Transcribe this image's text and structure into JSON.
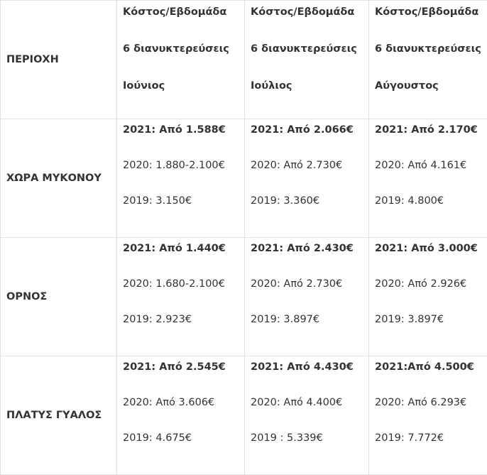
{
  "header": {
    "area_label": "ΠΕΡΙΟΧΗ",
    "columns": [
      {
        "line1": "Κόστος/Εβδομάδα",
        "line2": "6 διανυκτερεύσεις",
        "line3": "Ιούνιος"
      },
      {
        "line1": "Κόστος/Εβδομάδα",
        "line2": "6 διανυκτερεύσεις",
        "line3": "Ιούλιος"
      },
      {
        "line1": "Κόστος/Εβδομάδα",
        "line2": "6 διανυκτερεύσεις",
        "line3": "Αύγουστος"
      }
    ]
  },
  "rows": [
    {
      "area": "ΧΩΡΑ ΜΥΚΟΝΟΥ",
      "cells": [
        {
          "y2021": "2021: Από 1.588€",
          "y2020": "2020: 1.880-2.100€",
          "y2019": "2019: 3.150€"
        },
        {
          "y2021": "2021: Από 2.066€",
          "y2020": "2020: Από 2.730€",
          "y2019": "2019: 3.360€"
        },
        {
          "y2021": "2021: Από 2.170€",
          "y2020": "2020: Από 4.161€",
          "y2019": "2019: 4.800€"
        }
      ]
    },
    {
      "area": "ΟΡΝΟΣ",
      "cells": [
        {
          "y2021": "2021: Από 1.440€",
          "y2020": "2020: 1.680-2.100€",
          "y2019": "2019: 2.923€"
        },
        {
          "y2021": "2021: Από 2.430€",
          "y2020": "2020: Από 2.730€",
          "y2019": "2019: 3.897€"
        },
        {
          "y2021": "2021: Από 3.000€",
          "y2020": "2020: Από 2.926€",
          "y2019": "2019: 3.897€"
        }
      ]
    },
    {
      "area": "ΠΛΑΤΥΣ ΓΥΑΛΟΣ",
      "cells": [
        {
          "y2021": "2021: Από 2.545€",
          "y2020": "2020: Από 3.606€",
          "y2019": "2019: 4.675€"
        },
        {
          "y2021": "2021: Από 4.430€",
          "y2020": "2020: Από 4.400€",
          "y2019": "2019 : 5.339€"
        },
        {
          "y2021": "2021:Από 4.500€",
          "y2020": "2020: Από 6.293€",
          "y2019": "2019: 7.772€"
        }
      ]
    }
  ]
}
